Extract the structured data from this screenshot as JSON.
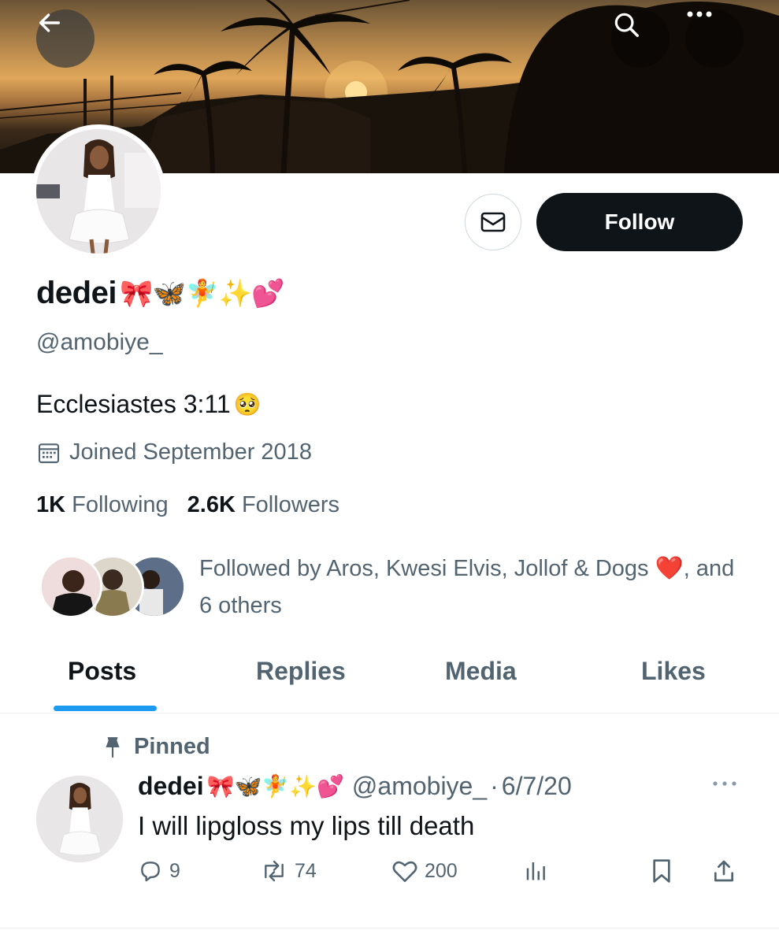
{
  "header": {
    "back_icon": "back-arrow-icon",
    "search_icon": "search-icon",
    "more_icon": "more-horizontal-icon"
  },
  "profile": {
    "display_name": "dedei",
    "display_name_emojis": "🎀🦋🧚✨💕",
    "handle": "@amobiye_",
    "bio": "Ecclesiastes 3:11",
    "bio_emoji": "🥺",
    "joined": "Joined September 2018",
    "following_count": "1K",
    "following_label": "Following",
    "followers_count": "2.6K",
    "followers_label": "Followers",
    "followed_by": "Followed by Aros, Kwesi Elvis, Jollof & Dogs",
    "followed_by_emoji": "❤️",
    "followed_by_rest": ", and 6 others"
  },
  "actions": {
    "message_icon": "envelope-icon",
    "follow_label": "Follow"
  },
  "tabs": [
    {
      "label": "Posts",
      "active": true
    },
    {
      "label": "Replies",
      "active": false
    },
    {
      "label": "Media",
      "active": false
    },
    {
      "label": "Likes",
      "active": false
    }
  ],
  "post": {
    "pinned_label": "Pinned",
    "author_name": "dedei",
    "author_emojis": "🎀🦋🧚✨💕",
    "author_handle": "@amobiye_",
    "date": "6/7/20",
    "text": "I will lipgloss my lips till death",
    "replies": "9",
    "reposts": "74",
    "likes": "200"
  },
  "colors": {
    "accent": "#1d9bf0",
    "text_primary": "#0f1419",
    "text_secondary": "#536471",
    "follow_button_bg": "#0f1419"
  }
}
